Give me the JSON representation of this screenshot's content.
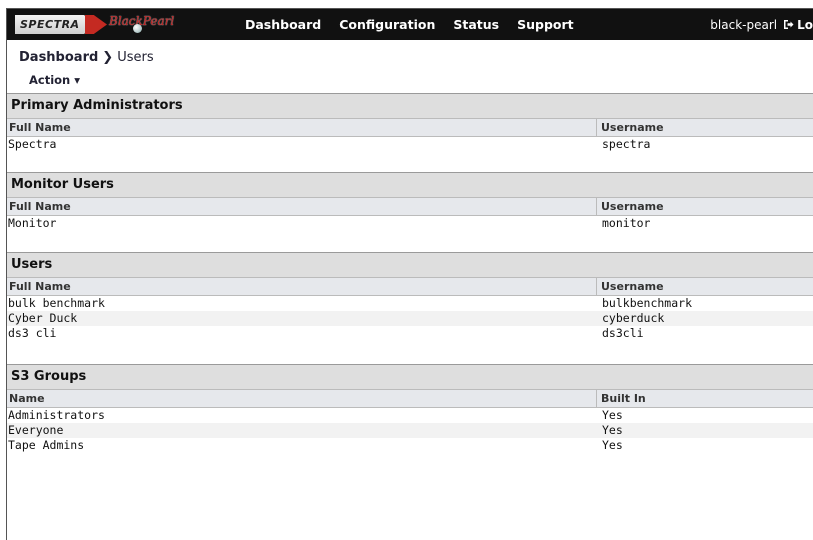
{
  "topbar": {
    "logo_spectra": "SPECTRA",
    "logo_product": "BlackPearl",
    "nav": [
      "Dashboard",
      "Configuration",
      "Status",
      "Support"
    ],
    "user": "black-pearl",
    "logout": "Lo"
  },
  "breadcrumb": {
    "root": "Dashboard",
    "current": "Users"
  },
  "action": {
    "label": "Action ▾"
  },
  "sections": {
    "primary": {
      "title": "Primary Administrators",
      "col1": "Full Name",
      "col2": "Username",
      "rows": [
        [
          "Spectra",
          "spectra"
        ]
      ]
    },
    "monitor": {
      "title": "Monitor Users",
      "col1": "Full Name",
      "col2": "Username",
      "rows": [
        [
          "Monitor",
          "monitor"
        ]
      ]
    },
    "users": {
      "title": "Users",
      "col1": "Full Name",
      "col2": "Username",
      "rows": [
        [
          "bulk benchmark",
          "bulkbenchmark"
        ],
        [
          "Cyber Duck",
          "cyberduck"
        ],
        [
          "ds3 cli",
          "ds3cli"
        ]
      ]
    },
    "groups": {
      "title": "S3 Groups",
      "col1": "Name",
      "col2": "Built In",
      "rows": [
        [
          "Administrators",
          "Yes"
        ],
        [
          "Everyone",
          "Yes"
        ],
        [
          "Tape Admins",
          "Yes"
        ]
      ]
    }
  }
}
